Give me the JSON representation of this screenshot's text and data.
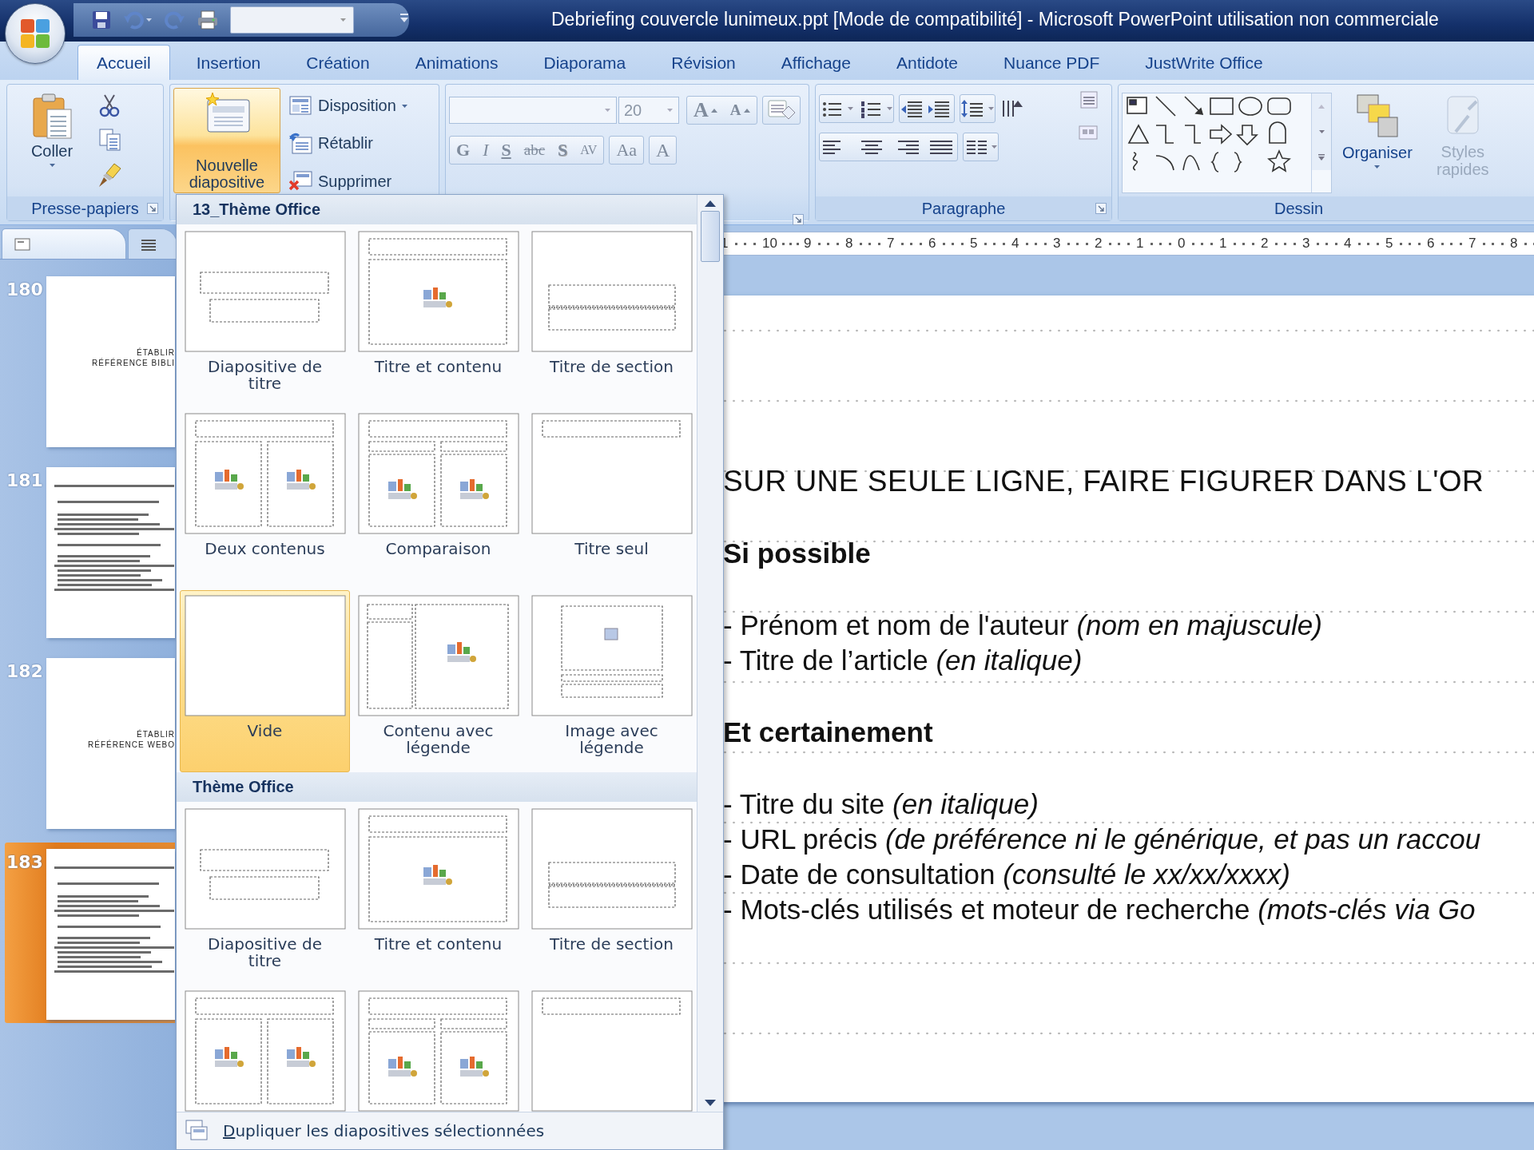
{
  "window": {
    "title": "Debriefing couvercle lunimeux.ppt [Mode de compatibilité] - Microsoft PowerPoint utilisation non commerciale"
  },
  "tabs": [
    {
      "label": "Accueil",
      "selected": true
    },
    {
      "label": "Insertion",
      "selected": false
    },
    {
      "label": "Création",
      "selected": false
    },
    {
      "label": "Animations",
      "selected": false
    },
    {
      "label": "Diaporama",
      "selected": false
    },
    {
      "label": "Révision",
      "selected": false
    },
    {
      "label": "Affichage",
      "selected": false
    },
    {
      "label": "Antidote",
      "selected": false
    },
    {
      "label": "Nuance PDF",
      "selected": false
    },
    {
      "label": "JustWrite Office",
      "selected": false
    }
  ],
  "clipboard": {
    "label": "Presse-papiers",
    "paste": "Coller"
  },
  "slides_group": {
    "new_slide": "Nouvelle diapositive",
    "open": true,
    "buttons": [
      {
        "kind": "layout",
        "label": "Disposition"
      },
      {
        "kind": "reset",
        "label": "Rétablir"
      },
      {
        "kind": "delete",
        "label": "Supprimer"
      }
    ]
  },
  "font": {
    "size": "20",
    "sizing": [
      {
        "kind": "grow",
        "label": "A"
      },
      {
        "kind": "shrink",
        "label": "A"
      }
    ],
    "styles": [
      {
        "kind": "bold",
        "label": "G"
      },
      {
        "kind": "italic",
        "label": "I"
      },
      {
        "kind": "underline",
        "label": "S"
      },
      {
        "kind": "strike",
        "label": "abc"
      },
      {
        "kind": "shadow",
        "label": "S"
      },
      {
        "kind": "spacing",
        "label": "AV"
      }
    ],
    "case": "Aa",
    "color_label": "A"
  },
  "paragraph": {
    "label": "Paragraphe"
  },
  "drawing": {
    "label": "Dessin",
    "arrange": "Organiser",
    "quick_styles": {
      "label": "Styles rapides",
      "disabled": true
    }
  },
  "panel_tabs": [
    {
      "kind": "slides",
      "selected": true
    },
    {
      "kind": "outline",
      "selected": false
    }
  ],
  "slides": [
    {
      "number": "180",
      "kind": "title",
      "selected": false,
      "lines": [
        "ÉTABLIR",
        "RÉFÉRENCE BIBLI"
      ]
    },
    {
      "number": "181",
      "kind": "text",
      "selected": false
    },
    {
      "number": "182",
      "kind": "title",
      "selected": false,
      "lines": [
        "ÉTABLIR",
        "RÉFÉRENCE WEBO"
      ]
    },
    {
      "number": "183",
      "kind": "text",
      "selected": true
    }
  ],
  "ruler": [
    "1",
    "10",
    "9",
    "8",
    "7",
    "6",
    "5",
    "4",
    "3",
    "2",
    "1",
    "0",
    "1",
    "2",
    "3",
    "4",
    "5",
    "6",
    "7",
    "8"
  ],
  "slide": {
    "paragraphs": [
      {
        "kind": "caps",
        "text": "SUR UNE SEULE LIGNE, FAIRE FIGURER DANS L'OR"
      },
      {
        "kind": "heading",
        "text": "Si possible"
      },
      {
        "kind": "bullet",
        "text": "- Prénom et nom de l'auteur *(nom en majuscule)*"
      },
      {
        "kind": "bullet",
        "text": "- Titre de l’article *(en italique)*"
      },
      {
        "kind": "heading",
        "text": "Et certainement"
      },
      {
        "kind": "bullet",
        "text": "- Titre du site *(en italique)*"
      },
      {
        "kind": "bullet",
        "text": "- URL précis *(de préférence ni le générique, et pas un raccou*"
      },
      {
        "kind": "bullet",
        "text": "- Date de consultation *(consulté le xx/xx/xxxx)*"
      },
      {
        "kind": "bullet",
        "text": "- Mots-clés utilisés et moteur de recherche *(mots-clés via Go*"
      }
    ]
  },
  "layout_gallery": {
    "sections": [
      {
        "title": "13_Thème Office",
        "layouts": [
          {
            "kind": "title",
            "label": "Diapositive de titre",
            "selected": false
          },
          {
            "kind": "title-content",
            "label": "Titre et contenu",
            "selected": false
          },
          {
            "kind": "section",
            "label": "Titre de section",
            "selected": false
          },
          {
            "kind": "two-content",
            "label": "Deux contenus",
            "selected": false
          },
          {
            "kind": "comparison",
            "label": "Comparaison",
            "selected": false
          },
          {
            "kind": "title-only",
            "label": "Titre seul",
            "selected": false
          },
          {
            "kind": "blank",
            "label": "Vide",
            "selected": true
          },
          {
            "kind": "content-caption",
            "label": "Contenu avec légende",
            "selected": false
          },
          {
            "kind": "picture-caption",
            "label": "Image avec légende",
            "selected": false
          }
        ]
      },
      {
        "title": "Thème Office",
        "layouts": [
          {
            "kind": "title",
            "label": "Diapositive de titre",
            "selected": false
          },
          {
            "kind": "title-content",
            "label": "Titre et contenu",
            "selected": false
          },
          {
            "kind": "section",
            "label": "Titre de section",
            "selected": false
          },
          {
            "kind": "two-content",
            "selected": false
          },
          {
            "kind": "comparison",
            "selected": false
          },
          {
            "kind": "title-only",
            "selected": false
          }
        ]
      }
    ],
    "footer": "Dupliquer les diapositives sélectionnées"
  }
}
